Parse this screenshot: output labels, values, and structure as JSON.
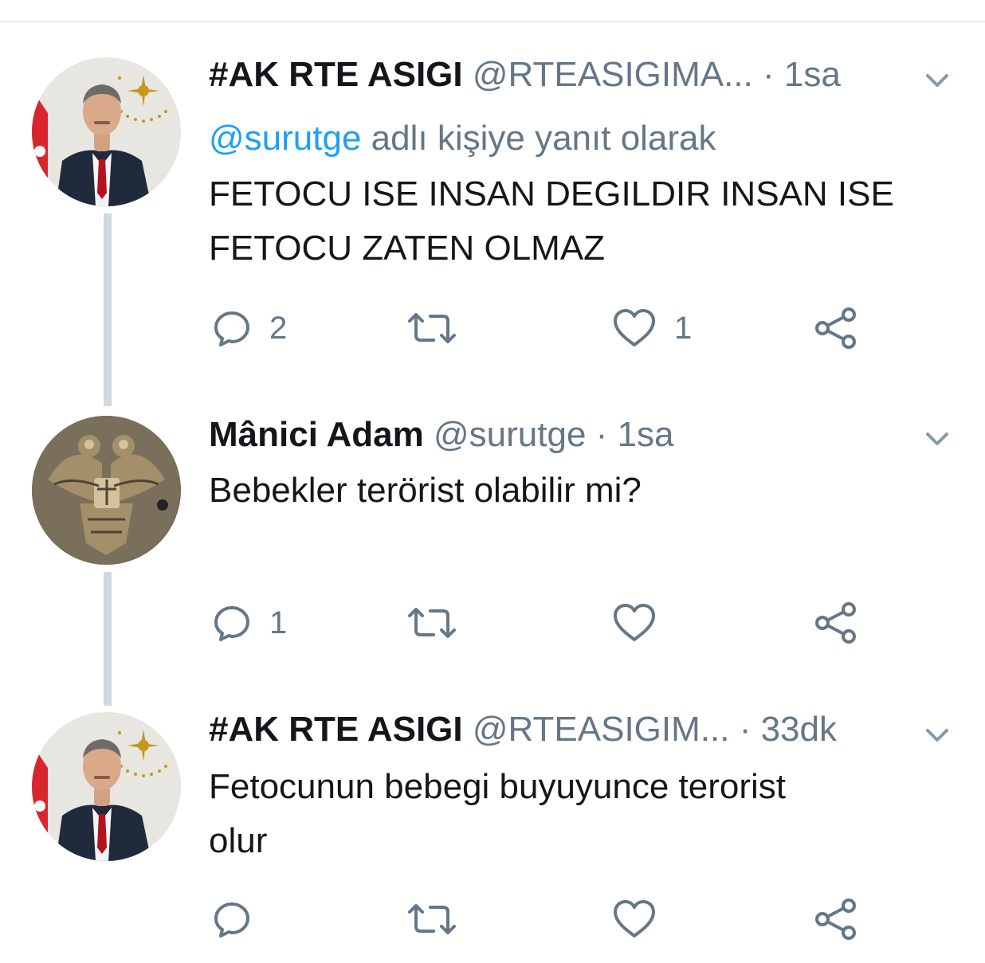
{
  "tweets": [
    {
      "name": "#AK RTE ASIGI",
      "handle": "@RTEASIGIMA...",
      "separator": "·",
      "time": "1sa",
      "reply_to": {
        "mention": "@surutge",
        "suffix": " adlı kişiye yanıt olarak"
      },
      "lines": [
        "FETOCU ISE INSAN DEGILDIR INSAN ISE",
        "FETOCU ZATEN OLMAZ"
      ],
      "counts": {
        "reply": "2",
        "retweet": "",
        "like": "1"
      }
    },
    {
      "name": "Mânici Adam",
      "handle": "@surutge",
      "separator": "·",
      "time": "1sa",
      "lines": [
        "Bebekler terörist olabilir mi?"
      ],
      "counts": {
        "reply": "1",
        "retweet": "",
        "like": ""
      }
    },
    {
      "name": "#AK RTE ASIGI",
      "handle": "@RTEASIGIM...",
      "separator": "·",
      "time": "33dk",
      "lines": [
        "Fetocunun bebegi buyuyunce terorist",
        "olur"
      ],
      "counts": {
        "reply": "",
        "retweet": "",
        "like": ""
      }
    }
  ],
  "icons": {
    "reply": "reply-icon",
    "retweet": "retweet-icon",
    "like": "heart-icon",
    "share": "share-icon",
    "menu": "chevron-down-icon"
  },
  "colors": {
    "text": "#14171a",
    "secondary": "#657786",
    "mention": "#1da1f2",
    "thread_line": "#cfd9de"
  }
}
